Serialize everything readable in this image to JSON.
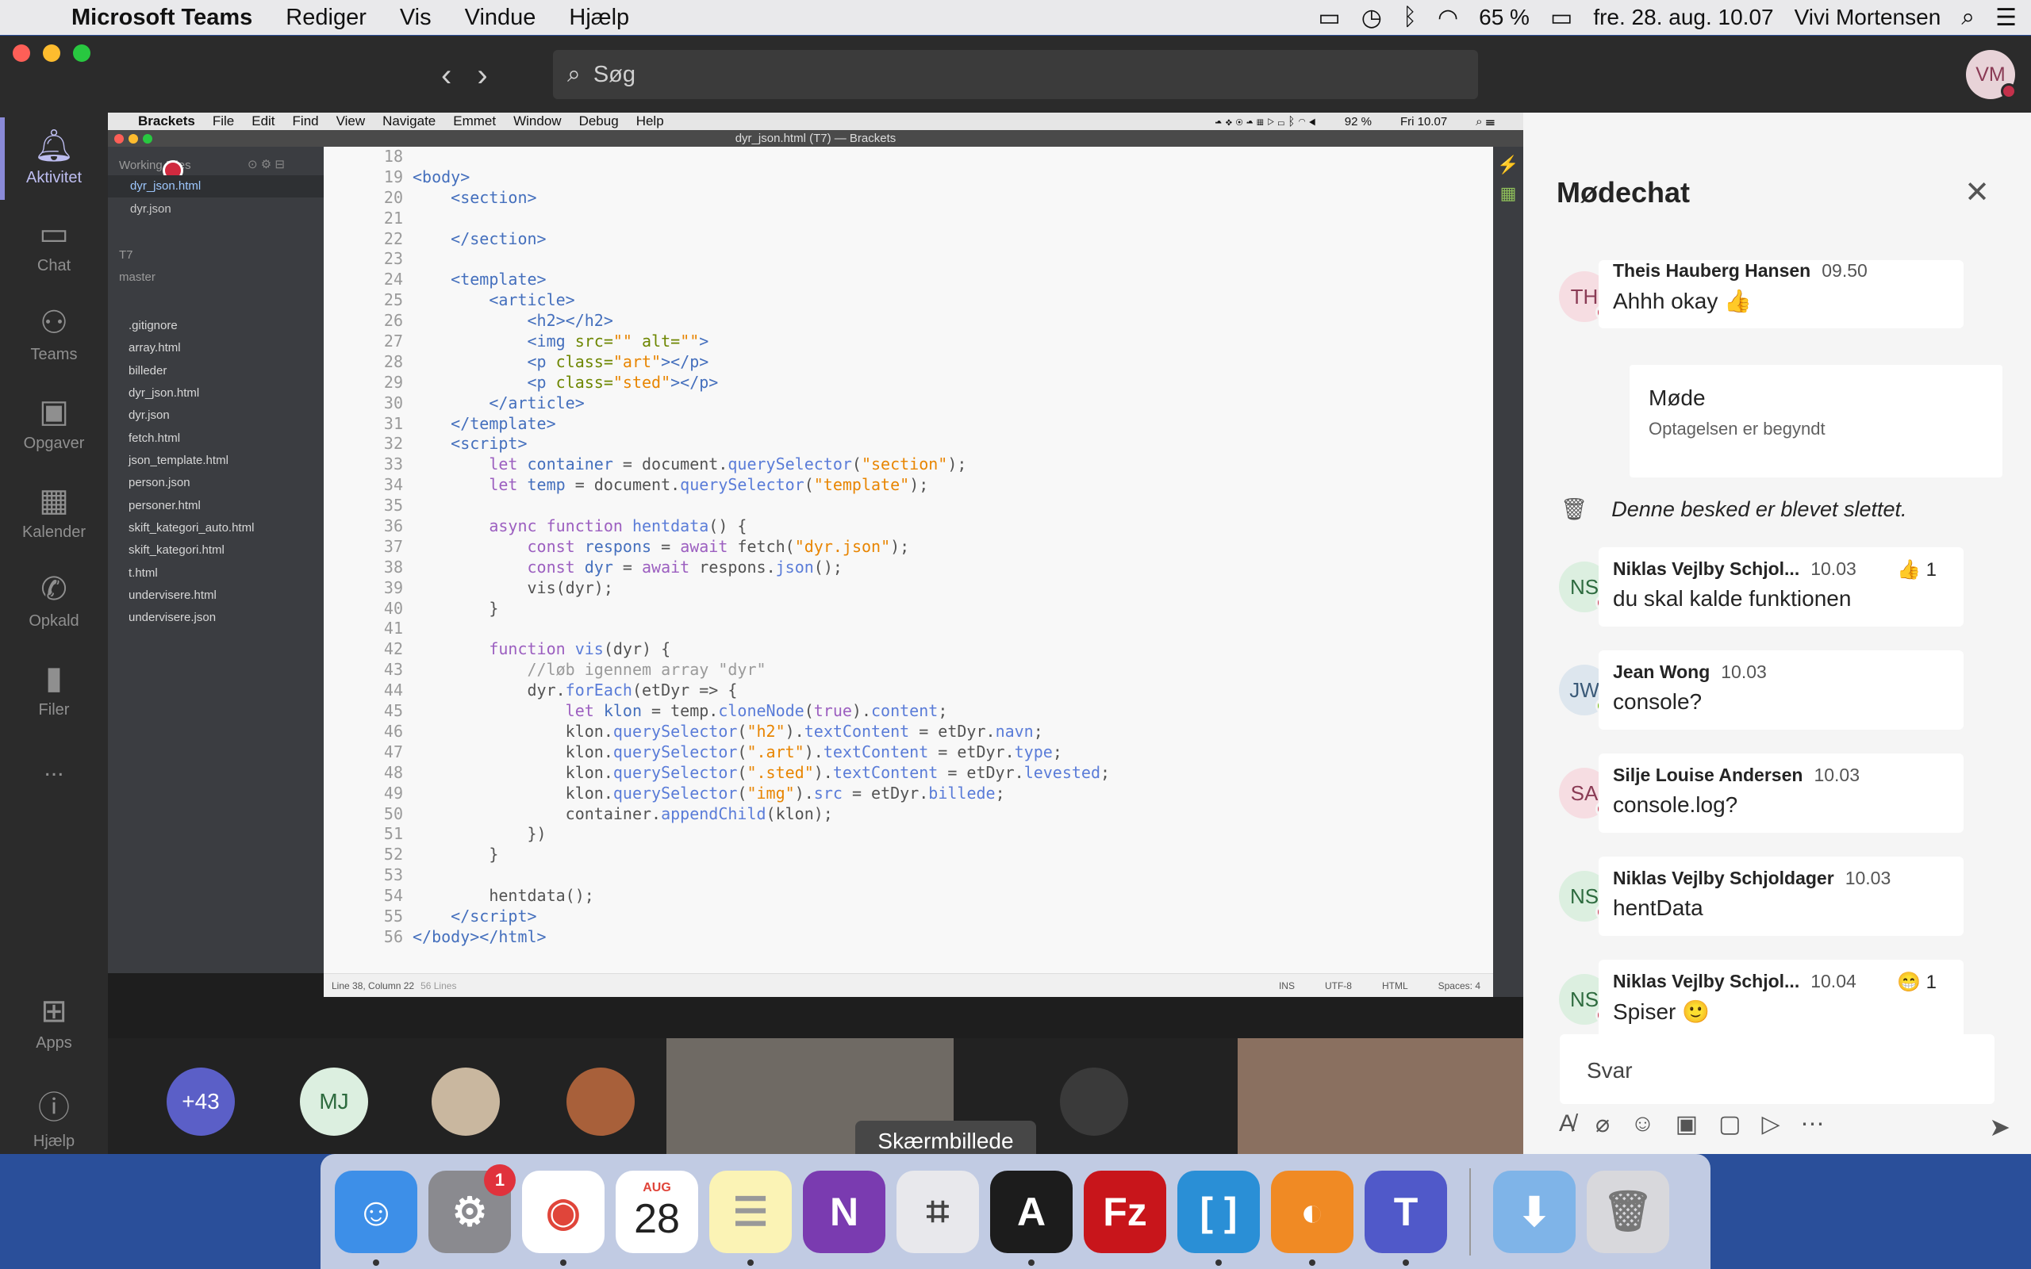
{
  "menubar": {
    "app": "Microsoft Teams",
    "items": [
      "Rediger",
      "Vis",
      "Vindue",
      "Hjælp"
    ],
    "battery": "65 %",
    "datetime": "fre. 28. aug. 10.07",
    "user": "Vivi Mortensen"
  },
  "teams": {
    "search_placeholder": "Søg",
    "user_initials": "VM",
    "rail": [
      {
        "label": "Aktivitet",
        "icon": "bell-icon"
      },
      {
        "label": "Chat",
        "icon": "chat-icon"
      },
      {
        "label": "Teams",
        "icon": "teams-icon"
      },
      {
        "label": "Opgaver",
        "icon": "assignments-icon"
      },
      {
        "label": "Kalender",
        "icon": "calendar-icon"
      },
      {
        "label": "Opkald",
        "icon": "phone-icon"
      },
      {
        "label": "Filer",
        "icon": "files-icon"
      },
      {
        "label": "...",
        "icon": "more-icon"
      },
      {
        "label": "Apps",
        "icon": "apps-icon"
      },
      {
        "label": "Hjælp",
        "icon": "help-icon"
      }
    ]
  },
  "brackets": {
    "menubar": [
      "Brackets",
      "File",
      "Edit",
      "Find",
      "View",
      "Navigate",
      "Emmet",
      "Window",
      "Debug",
      "Help"
    ],
    "battery": "92 %",
    "clock": "Fri 10.07",
    "window_title": "dyr_json.html (T7) — Brackets",
    "working_files_label": "Working Files",
    "working_files": [
      "dyr_json.html",
      "dyr.json"
    ],
    "project": "T7",
    "branch": "master",
    "project_files": [
      ".gitignore",
      "array.html",
      "billeder",
      "dyr_json.html",
      "dyr.json",
      "fetch.html",
      "json_template.html",
      "person.json",
      "personer.html",
      "skift_kategori_auto.html",
      "skift_kategori.html",
      "t.html",
      "undervisere.html",
      "undervisere.json"
    ],
    "line_numbers": [
      "18",
      "19",
      "20",
      "21",
      "22",
      "23",
      "24",
      "25",
      "26",
      "27",
      "28",
      "29",
      "30",
      "31",
      "32",
      "33",
      "34",
      "35",
      "36",
      "37",
      "38",
      "39",
      "40",
      "41",
      "42",
      "43",
      "44",
      "45",
      "46",
      "47",
      "48",
      "49",
      "50",
      "51",
      "52",
      "53",
      "54",
      "55",
      "56"
    ],
    "status": {
      "cursor": "Line 38, Column 22",
      "lines": "56 Lines",
      "mode": "INS",
      "encoding": "UTF-8",
      "language": "HTML",
      "spaces": "Spaces: 4"
    }
  },
  "gallery": {
    "more_count": "+43",
    "mj_initials": "MJ",
    "tooltip": "Skærmbillede"
  },
  "chat": {
    "title": "Mødechat",
    "meeting_card_title": "Møde",
    "meeting_card_subtitle": "Optagelsen er begyndt",
    "deleted": "Denne besked er blevet slettet.",
    "reply_placeholder": "Svar",
    "messages": [
      {
        "initials": "TH",
        "name": "Theis Hauberg Hansen",
        "time": "09.50",
        "text": "Ahhh okay 👍",
        "reaction": ""
      },
      {
        "initials": "NS",
        "name": "Niklas Vejlby Schjol...",
        "time": "10.03",
        "text": "du skal kalde funktionen",
        "reaction": "👍 1"
      },
      {
        "initials": "JW",
        "name": "Jean Wong",
        "time": "10.03",
        "text": "console?",
        "reaction": ""
      },
      {
        "initials": "SA",
        "name": "Silje Louise Andersen",
        "time": "10.03",
        "text": "console.log?",
        "reaction": ""
      },
      {
        "initials": "NS",
        "name": "Niklas Vejlby Schjoldager",
        "time": "10.03",
        "text": "hentData",
        "reaction": ""
      },
      {
        "initials": "NS",
        "name": "Niklas Vejlby Schjol...",
        "time": "10.04",
        "text": "Spiser 🙂",
        "reaction": "😁 1"
      }
    ]
  },
  "dock": {
    "calendar_month": "AUG",
    "calendar_day": "28",
    "settings_badge": "1",
    "apps": [
      "finder-icon",
      "system-preferences-icon",
      "chrome-icon",
      "calendar-icon",
      "notes-icon",
      "onenote-icon",
      "screenshot-icon",
      "acrobat-icon",
      "filezilla-icon",
      "brackets-icon",
      "firefox-icon",
      "teams-icon",
      "downloads-icon",
      "trash-icon"
    ]
  }
}
